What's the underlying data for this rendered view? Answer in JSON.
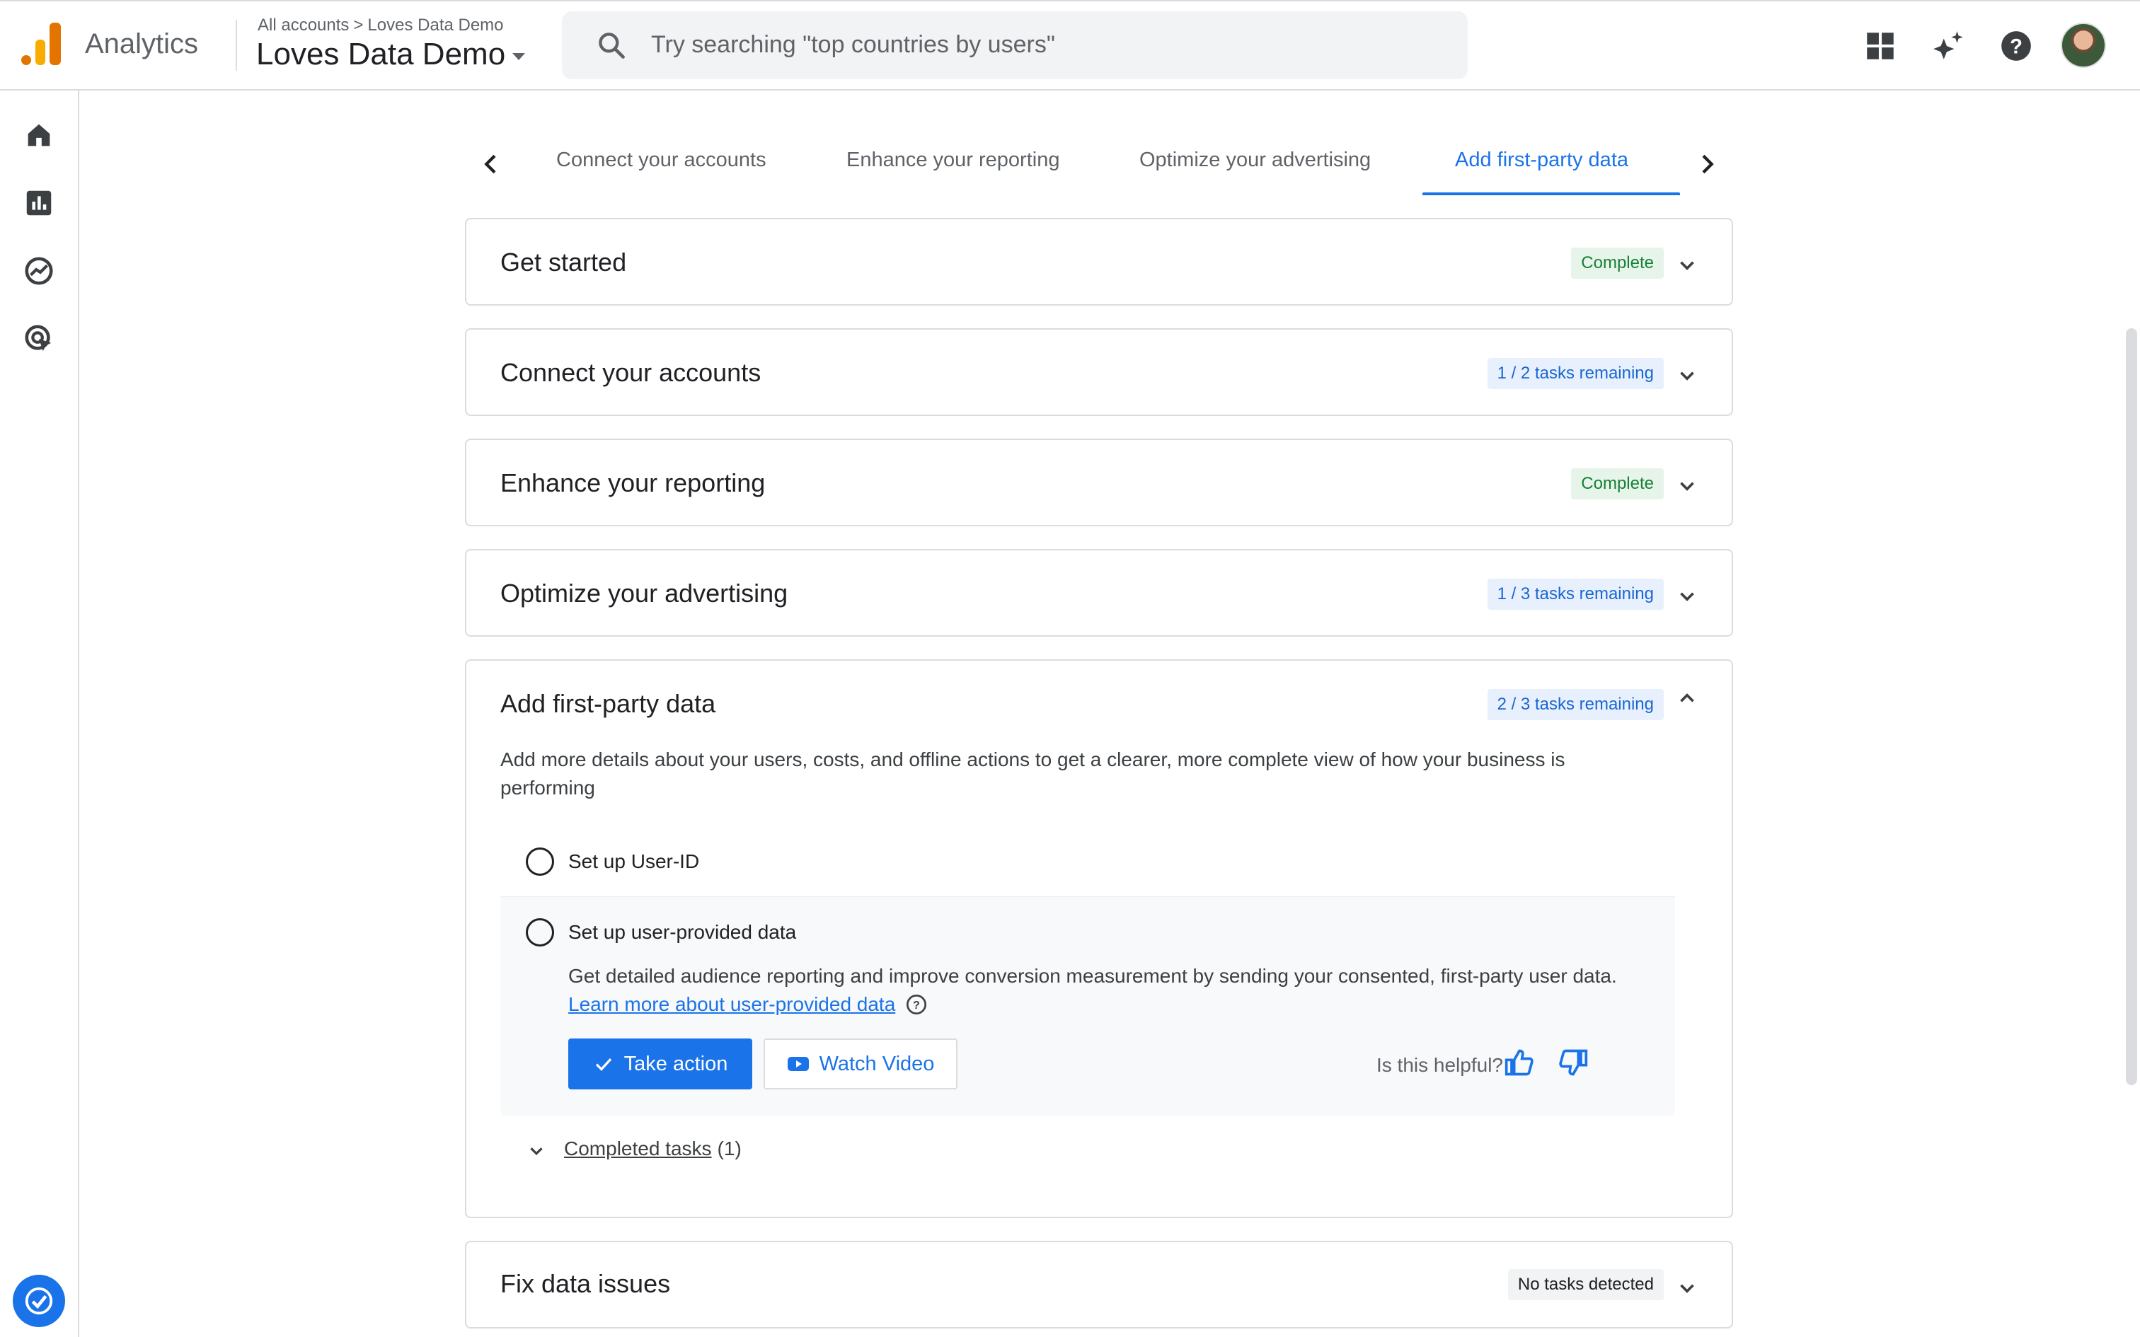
{
  "header": {
    "app_name": "Analytics",
    "breadcrumb": {
      "account": "All accounts",
      "property": "Loves Data Demo"
    },
    "property_selector": "Loves Data Demo",
    "search_placeholder": "Try searching \"top countries by users\"",
    "icons": [
      "apps-grid-icon",
      "sparkle-insights-icon",
      "help-icon",
      "avatar"
    ]
  },
  "leftnav": {
    "items": [
      "home-icon",
      "reports-icon",
      "explore-icon",
      "advertising-icon"
    ],
    "bottom": [
      "setup-assistant-icon",
      "admin-gear-icon"
    ]
  },
  "tabs": {
    "items": [
      {
        "label": "Connect your accounts",
        "active": false
      },
      {
        "label": "Enhance your reporting",
        "active": false
      },
      {
        "label": "Optimize your advertising",
        "active": false
      },
      {
        "label": "Add first-party data",
        "active": true
      }
    ]
  },
  "sections": [
    {
      "title": "Get started",
      "status": "Complete",
      "status_type": "complete"
    },
    {
      "title": "Connect your accounts",
      "status": "1 / 2 tasks remaining",
      "status_type": "remaining"
    },
    {
      "title": "Enhance your reporting",
      "status": "Complete",
      "status_type": "complete"
    },
    {
      "title": "Optimize your advertising",
      "status": "1 / 3 tasks remaining",
      "status_type": "remaining"
    },
    {
      "title": "Add first-party data",
      "status": "2 / 3 tasks remaining",
      "status_type": "remaining",
      "expanded": true
    },
    {
      "title": "Fix data issues",
      "status": "No tasks detected",
      "status_type": "none"
    }
  ],
  "expanded": {
    "description": "Add more details about your users, costs, and offline actions to get a clearer, more complete view of how your business is performing",
    "tasks": [
      {
        "label": "Set up User-ID"
      },
      {
        "label": "Set up user-provided data",
        "description": "Get detailed audience reporting and improve conversion measurement by sending your consented, first-party user data.",
        "link": "Learn more about user-provided data",
        "take_action": "Take action",
        "watch_video": "Watch Video",
        "helpful_prompt": "Is this helpful?"
      }
    ],
    "completed_tasks": {
      "label": "Completed tasks",
      "count": "(1)"
    }
  },
  "colors": {
    "accent": "#1a73e8",
    "complete": "#188038",
    "logo_orange": "#f9ab00",
    "logo_dark_orange": "#e37400"
  }
}
